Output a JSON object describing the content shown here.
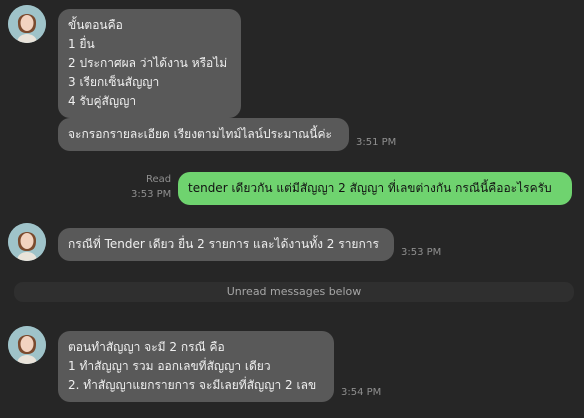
{
  "messages": {
    "m1": {
      "lines": [
        "ขั้นตอนคือ",
        "1 ยื่น",
        "2 ประกาศผล ว่าได้งาน หรือไม่",
        "3 เรียกเซ็นสัญญา",
        "4 รับคู่สัญญา"
      ]
    },
    "m2": {
      "text": "จะกรอกรายละเอียด เรียงตามไทม์ไลน์ประมาณนี้ค่ะ",
      "time": "3:51 PM"
    },
    "m3": {
      "text": "tender เดียวกัน แต่มีสัญญา 2 สัญญา ที่เลขต่างกัน กรณีนี้คืออะไรครับ",
      "read": "Read",
      "time": "3:53 PM"
    },
    "m4": {
      "text": "กรณีที่ Tender เดียว ยื่น 2 รายการ และได้งานทั้ง 2 รายการ",
      "time": "3:53 PM"
    },
    "divider": "Unread messages below",
    "m5": {
      "lines": [
        "ตอนทำสัญญา จะมี 2 กรณี คือ",
        "1 ทำสัญญา รวม ออกเลขที่สัญญา เดียว",
        "2. ทำสัญญาแยกรายการ จะมีเลยที่สัญญา 2 เลข"
      ],
      "time": "3:54 PM"
    }
  },
  "colors": {
    "background": "#262626",
    "incoming_bubble": "#595959",
    "outgoing_bubble": "#6fd36f"
  },
  "icons": [
    "avatar"
  ]
}
